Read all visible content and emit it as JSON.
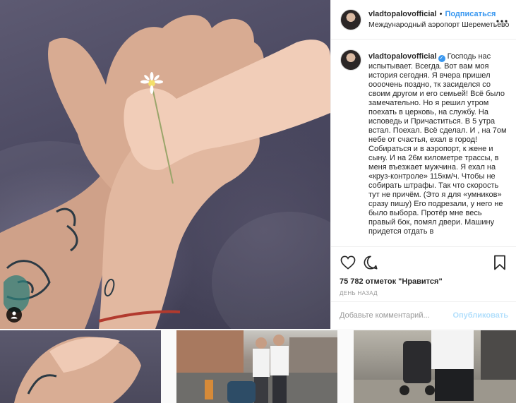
{
  "post": {
    "username": "vladtopalovofficial",
    "follow_label": "Подписаться",
    "location": "Международный аэропорт Шереметьево",
    "caption": "Господь нас испытывает. Всегда. Вот вам моя история сегодня. Я вчера пришел оооочень поздно, тк засиделся со своим другом и его семьей! Всё было замечательно. Но я решил утром поехать в церковь, на службу. На исповедь и Причаститься. В 5 утра встал. Поехал. Всё сделал. И , на 7ом небе от счастья, ехал в город! Собираться и в аэропорт, к жене и сыну. И на 26м километре трассы, в меня въезжает мужчина. Я ехал на «круз-контроле» 115км/ч. Чтобы не собирать штрафы. Так что скорость тут не причём. (Это я для «умников» сразу пишу) Его подрезали, у него не было выбора. Протёр мне весь правый бок, помял двери. Машину придется отдать в",
    "likes": "75 782 отметок \"Нравится\"",
    "time": "ДЕНЬ НАЗАД",
    "comment_placeholder": "Добавьте комментарий...",
    "publish_label": "Опубликовать"
  },
  "icons": {
    "more": "more-icon",
    "like": "heart-icon",
    "comment": "comment-icon",
    "save": "bookmark-icon",
    "user_tag": "user-tag-icon",
    "verified": "verified-badge-icon"
  },
  "colors": {
    "accent": "#3897f0",
    "publish_disabled": "#b2dffc",
    "muted": "#999999",
    "text": "#262626"
  }
}
